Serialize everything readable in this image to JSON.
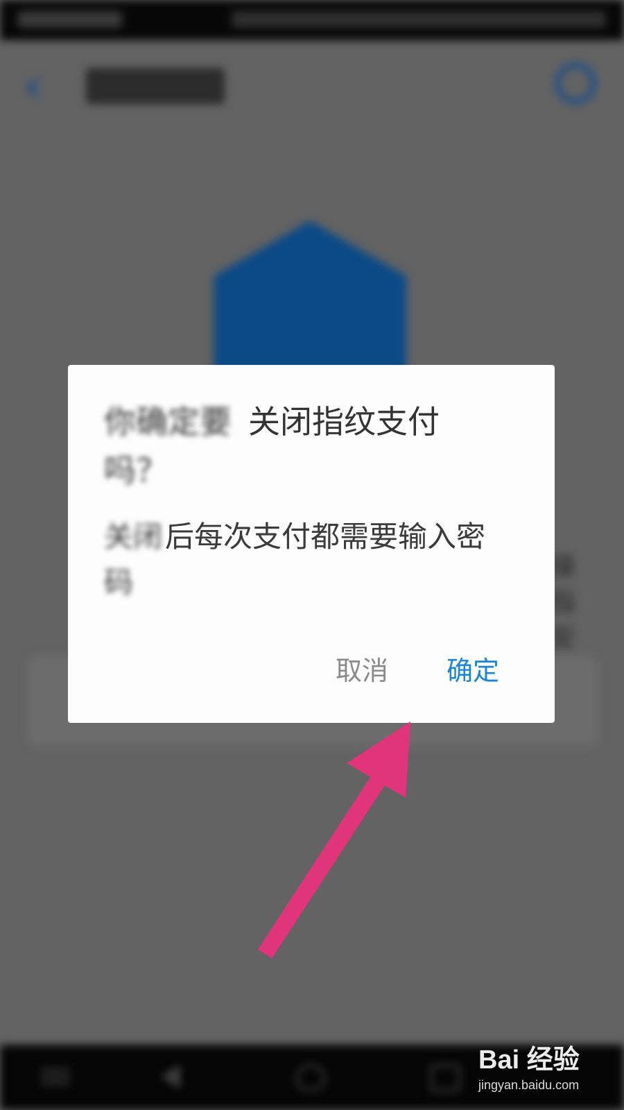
{
  "background_page": {
    "right_text_fragments": [
      "操",
      "指",
      "安"
    ]
  },
  "dialog": {
    "title_blurred_part": "你确定要",
    "title_visible_part": "关闭指纹支付",
    "title_line2": "吗？",
    "message_blurred_part": "关闭",
    "message_visible_part": "后每次支付都需要输入密",
    "message_line2": "码",
    "cancel_label": "取消",
    "confirm_label": "确定"
  },
  "colors": {
    "confirm_accent": "#1a84d6",
    "annotation_arrow": "#e0357a",
    "shield_blue": "#0b4a86"
  },
  "watermark": {
    "logo": "Bai 经验",
    "url": "jingyan.baidu.com"
  }
}
